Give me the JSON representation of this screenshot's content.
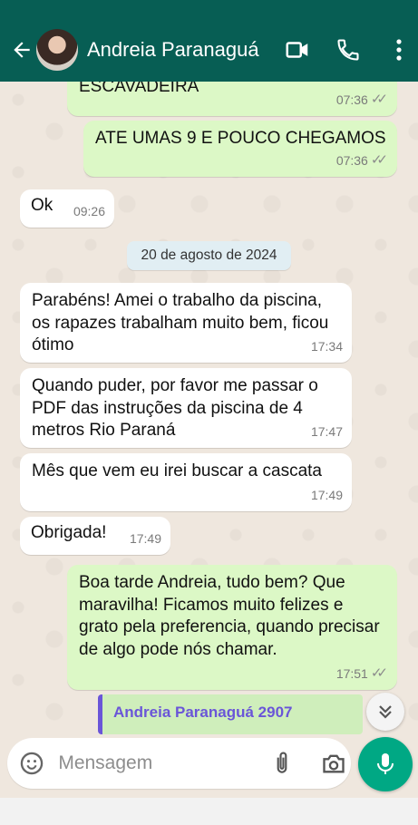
{
  "header": {
    "contact_name": "Andreia Paranaguá",
    "icons": [
      "back-arrow-icon",
      "avatar",
      "video-call-icon",
      "phone-icon",
      "more-vert-icon"
    ]
  },
  "messages": [
    {
      "direction": "out",
      "text": "ESCAVADEIRA",
      "time": "07:36",
      "status": "read"
    },
    {
      "direction": "out",
      "text": "ATE UMAS 9 E POUCO CHEGAMOS",
      "time": "07:36",
      "status": "read"
    },
    {
      "direction": "in",
      "text": "Ok",
      "time": "09:26"
    },
    {
      "direction": "in",
      "text": "Parabéns! Amei o trabalho da piscina, os rapazes trabalham muito bem, ficou ótimo",
      "time": "17:34"
    },
    {
      "direction": "in",
      "text": "Quando puder, por favor me passar o PDF das instruções da piscina de 4 metros Rio Paraná",
      "time": "17:47"
    },
    {
      "direction": "in",
      "text": "Mês que vem eu irei buscar a cascata",
      "time": "17:49"
    },
    {
      "direction": "in",
      "text": "Obrigada!",
      "time": "17:49"
    },
    {
      "direction": "out",
      "text": "Boa tarde Andreia, tudo bem? Que maravilha! Ficamos muito felizes e grato pela preferencia, quando precisar de algo pode nós chamar.",
      "time": "17:51",
      "status": "read"
    }
  ],
  "date_divider": "20 de agosto de 2024",
  "quoted_message": {
    "author": "Andreia Paranaguá 2907"
  },
  "composer": {
    "placeholder": "Mensagem",
    "value": ""
  },
  "colors": {
    "header": "#075e54",
    "outgoing_bubble": "#dcf8c6",
    "incoming_bubble": "#ffffff",
    "accent": "#00a884",
    "chat_background": "#efe7de"
  }
}
